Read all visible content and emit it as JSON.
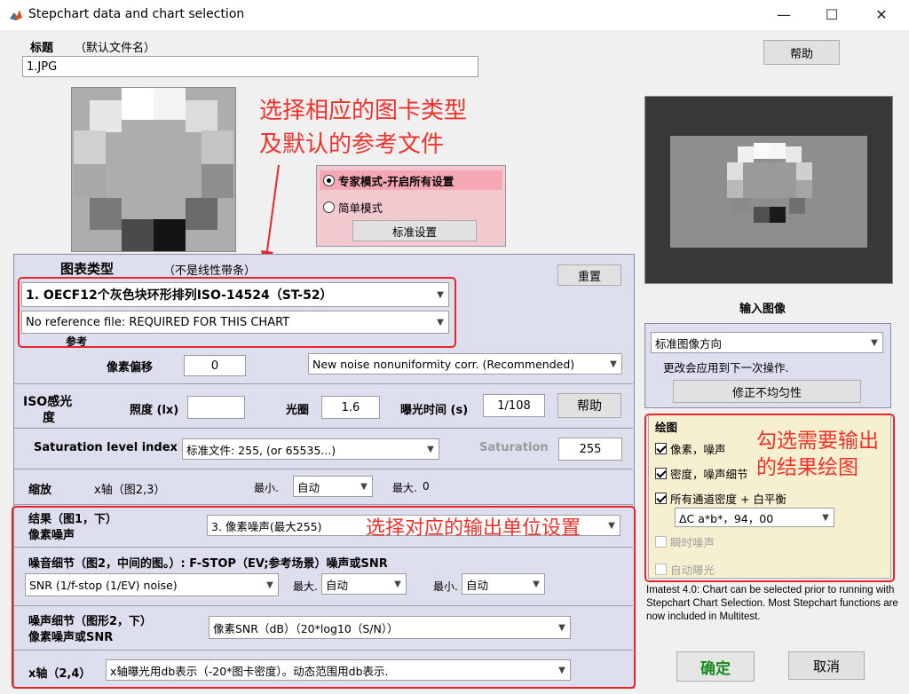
{
  "window": {
    "title": "Stepchart data and chart selection",
    "minimize": "—",
    "maximize": "☐",
    "close": "✕"
  },
  "title_section": {
    "label": "标题",
    "hint": "（默认文件名）",
    "value": "1.JPG"
  },
  "help_top": "帮助",
  "annotations": {
    "chart_type_1": "选择相应的图卡类型",
    "chart_type_2": "及默认的参考文件",
    "output_1": "勾选需要输出",
    "output_2": "的结果绘图",
    "units": "选择对应的输出单位设置"
  },
  "mode": {
    "expert": "专家模式-开启所有设置",
    "simple": "简单模式",
    "standard_settings": "标准设置"
  },
  "chart_type": {
    "label": "图表类型",
    "hint": "（不是线性带条）",
    "reset": "重置",
    "selected": "1.   OECF12个灰色块环形排列ISO-14524（ST-52）",
    "reference": "No reference file: REQUIRED FOR THIS CHART",
    "reference_label": "参考"
  },
  "pixel_offset": {
    "label": "像素偏移",
    "value": "0",
    "noise_option": "New noise nonuniformity corr. (Recommended)"
  },
  "iso": {
    "label_1": "ISO感光",
    "label_2": "度",
    "illuminance": "照度 (lx)",
    "illuminance_value": "",
    "aperture": "光圈",
    "aperture_value": "1.6",
    "exposure": "曝光时间 (s)",
    "exposure_value": "1/108",
    "help": "帮助"
  },
  "saturation": {
    "label": "Saturation level index",
    "option": "标准文件:  255, (or 65535...)",
    "sat_label": "Saturation",
    "value": "255"
  },
  "scale": {
    "label": "缩放",
    "x_axis": "x轴（图2,3）",
    "min_label": "最小.",
    "min_value": "自动",
    "max_label": "最大.",
    "max_value": "0"
  },
  "results": {
    "label_1": "结果（图1，下）",
    "label_2": "像素噪声",
    "option": "3. 像素噪声(最大255)"
  },
  "noise_detail": {
    "label": "噪音细节（图2，中间的图。）: F-STOP（EV;参考场景）噪声或SNR",
    "option": "SNR (1/f-stop (1/EV) noise)",
    "max_label": "最大.",
    "max_value": "自动",
    "min_label": "最小.",
    "min_value": "自动"
  },
  "noise_detail2": {
    "label_1": "噪声细节（图形2，下）",
    "label_2": "像素噪声或SNR",
    "option": "像素SNR（dB）（20*log10（S/N））"
  },
  "x_axis": {
    "label": "x轴（2,4）",
    "option": "x轴曝光用db表示（-20*图卡密度）。动态范围用db表示."
  },
  "input_image": {
    "label": "输入图像",
    "orientation": "标准图像方向",
    "note": "更改会应用到下一次操作.",
    "fix_button": "修正不均匀性"
  },
  "plot": {
    "label": "绘图",
    "pixel_noise": "像素，噪声",
    "density_noise": "密度，噪声细节",
    "all_channels": "所有通道密度 + 白平衡",
    "delta_option": "ΔC a*b*，94，00",
    "instant_noise": "瞬时噪声",
    "auto_exposure": "自动曝光"
  },
  "info_text": "Imatest 4.0: Chart can be selected prior to running with Stepchart Chart Selection. Most Stepchart functions are now included in Multitest.",
  "ok": "确定",
  "cancel": "取消",
  "colors": {
    "panel": "#dedfee",
    "red": "#e8262a",
    "ok_green": "#1a8a1a"
  }
}
